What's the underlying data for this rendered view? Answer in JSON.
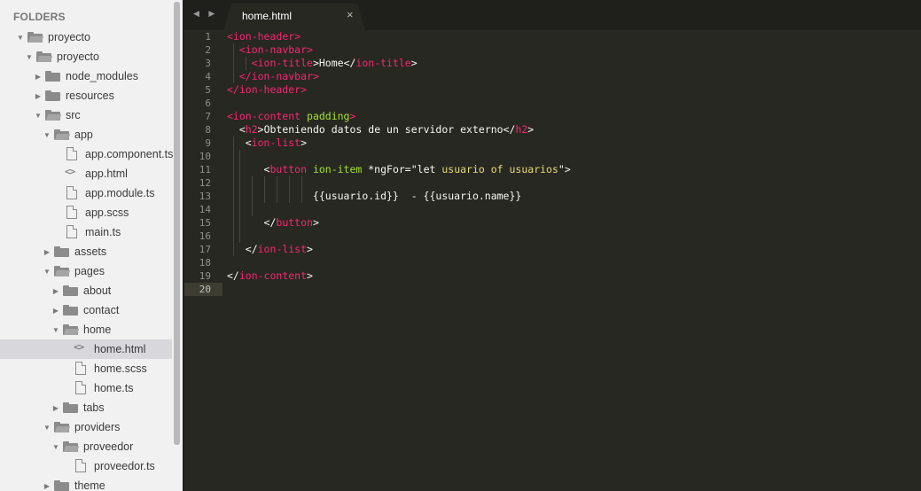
{
  "sidebar": {
    "header": "FOLDERS",
    "items": [
      {
        "label": "proyecto",
        "type": "folder-open",
        "depth": 0
      },
      {
        "label": "proyecto",
        "type": "folder-open",
        "depth": 1
      },
      {
        "label": "node_modules",
        "type": "folder",
        "depth": 2
      },
      {
        "label": "resources",
        "type": "folder",
        "depth": 2
      },
      {
        "label": "src",
        "type": "folder-open",
        "depth": 2
      },
      {
        "label": "app",
        "type": "folder-open",
        "depth": 3
      },
      {
        "label": "app.component.ts",
        "type": "file",
        "depth": 4
      },
      {
        "label": "app.html",
        "type": "code",
        "depth": 4
      },
      {
        "label": "app.module.ts",
        "type": "file",
        "depth": 4
      },
      {
        "label": "app.scss",
        "type": "file",
        "depth": 4
      },
      {
        "label": "main.ts",
        "type": "file",
        "depth": 4
      },
      {
        "label": "assets",
        "type": "folder",
        "depth": 3
      },
      {
        "label": "pages",
        "type": "folder-open",
        "depth": 3
      },
      {
        "label": "about",
        "type": "folder",
        "depth": 4
      },
      {
        "label": "contact",
        "type": "folder",
        "depth": 4
      },
      {
        "label": "home",
        "type": "folder-open",
        "depth": 4
      },
      {
        "label": "home.html",
        "type": "code",
        "depth": 5,
        "selected": true
      },
      {
        "label": "home.scss",
        "type": "file",
        "depth": 5
      },
      {
        "label": "home.ts",
        "type": "file",
        "depth": 5
      },
      {
        "label": "tabs",
        "type": "folder",
        "depth": 4
      },
      {
        "label": "providers",
        "type": "folder-open",
        "depth": 3
      },
      {
        "label": "proveedor",
        "type": "folder-open",
        "depth": 4
      },
      {
        "label": "proveedor.ts",
        "type": "file",
        "depth": 5
      },
      {
        "label": "theme",
        "type": "folder",
        "depth": 3
      }
    ]
  },
  "tabbar": {
    "nav": "◀ ▶",
    "tab_title": "home.html",
    "close": "×"
  },
  "editor": {
    "current_line": 20,
    "lines": [
      [
        [
          "tag",
          "<"
        ],
        [
          "tag",
          "ion-header"
        ],
        [
          "tag",
          ">"
        ]
      ],
      [
        [
          "txt",
          "  "
        ],
        [
          "tag",
          "<ion-navbar>"
        ]
      ],
      [
        [
          "txt",
          "    "
        ],
        [
          "tag",
          "<ion-title"
        ],
        [
          "txt",
          ">Home</"
        ],
        [
          "tag",
          "ion-title"
        ],
        [
          "txt",
          ">"
        ]
      ],
      [
        [
          "txt",
          "  "
        ],
        [
          "tag",
          "</ion-navbar>"
        ]
      ],
      [
        [
          "tag",
          "</ion-header>"
        ]
      ],
      [],
      [
        [
          "tag",
          "<ion-content "
        ],
        [
          "attr",
          "padding"
        ],
        [
          "tag",
          ">"
        ]
      ],
      [
        [
          "txt",
          "  <"
        ],
        [
          "tag",
          "h2"
        ],
        [
          "txt",
          ">Obteniendo datos de un servidor externo</"
        ],
        [
          "tag",
          "h2"
        ],
        [
          "txt",
          ">"
        ]
      ],
      [
        [
          "txt",
          "   <"
        ],
        [
          "tag",
          "ion-list"
        ],
        [
          "txt",
          ">"
        ]
      ],
      [],
      [
        [
          "txt",
          "      <"
        ],
        [
          "tag",
          "button "
        ],
        [
          "attr",
          "ion-item"
        ],
        [
          "txt",
          " *ngFor=\""
        ],
        [
          "txt",
          "let "
        ],
        [
          "str",
          "usuario of usuarios"
        ],
        [
          "txt",
          "\">"
        ]
      ],
      [],
      [
        [
          "txt",
          "              {{usuario.id}}  - {{usuario.name}}"
        ]
      ],
      [],
      [
        [
          "txt",
          "      </"
        ],
        [
          "tag",
          "button"
        ],
        [
          "txt",
          ">"
        ]
      ],
      [],
      [
        [
          "txt",
          "   </"
        ],
        [
          "tag",
          "ion-list"
        ],
        [
          "txt",
          ">"
        ]
      ],
      [],
      [
        [
          "txt",
          "</"
        ],
        [
          "tag",
          "ion-content"
        ],
        [
          "txt",
          ">"
        ]
      ],
      []
    ]
  }
}
